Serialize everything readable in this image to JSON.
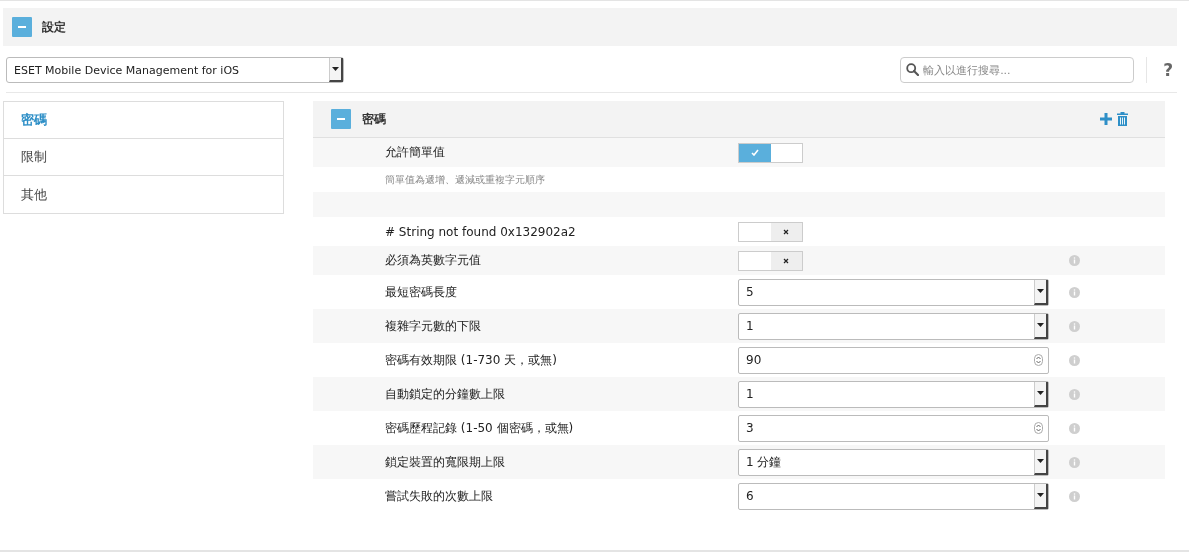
{
  "header": {
    "title": "設定",
    "expanded": true
  },
  "product_select": {
    "value": "ESET Mobile Device Management for iOS"
  },
  "search": {
    "placeholder": "輸入以進行搜尋..."
  },
  "help": "?",
  "sidebar": {
    "items": [
      {
        "label": "密碼",
        "selected": true
      },
      {
        "label": "限制",
        "selected": false
      },
      {
        "label": "其他",
        "selected": false
      }
    ]
  },
  "section": {
    "title": "密碼",
    "expanded": true,
    "settings": [
      {
        "kind": "toggle",
        "label": "允許簡單值",
        "on": true,
        "description": "簡單值為遞增、遞減或重複字元順序",
        "info": false
      },
      {
        "kind": "spacer"
      },
      {
        "kind": "toggle",
        "label": "# String not found 0x132902a2",
        "on": false,
        "info": false
      },
      {
        "kind": "toggle",
        "label": "必須為英數字元值",
        "on": false,
        "info": true
      },
      {
        "kind": "select",
        "label": "最短密碼長度",
        "value": "5",
        "info": true
      },
      {
        "kind": "select",
        "label": "複雜字元數的下限",
        "value": "1",
        "info": true
      },
      {
        "kind": "number",
        "label": "密碼有效期限 (1-730 天，或無)",
        "value": "90",
        "info": true
      },
      {
        "kind": "select",
        "label": "自動鎖定的分鐘數上限",
        "value": "1",
        "info": true
      },
      {
        "kind": "number",
        "label": "密碼歷程記錄 (1-50 個密碼，或無)",
        "value": "3",
        "info": true
      },
      {
        "kind": "select",
        "label": "鎖定裝置的寬限期上限",
        "value": "1 分鐘",
        "info": true
      },
      {
        "kind": "select",
        "label": "嘗試失敗的次數上限",
        "value": "6",
        "info": true
      }
    ]
  }
}
